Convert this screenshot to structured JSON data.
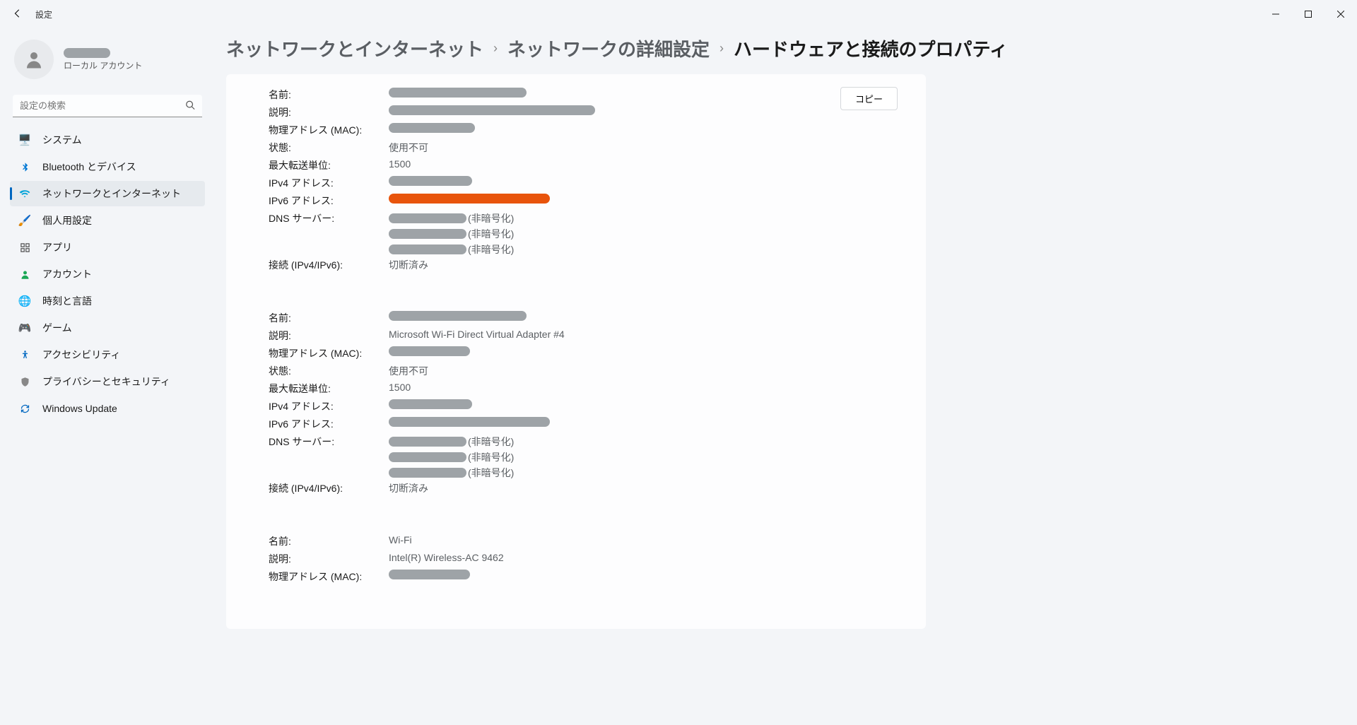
{
  "window": {
    "title": "設定"
  },
  "user": {
    "subtitle": "ローカル アカウント"
  },
  "search": {
    "placeholder": "設定の検索"
  },
  "nav": {
    "items": [
      {
        "key": "system",
        "label": "システム"
      },
      {
        "key": "bluetooth",
        "label": "Bluetooth とデバイス"
      },
      {
        "key": "network",
        "label": "ネットワークとインターネット"
      },
      {
        "key": "personalize",
        "label": "個人用設定"
      },
      {
        "key": "apps",
        "label": "アプリ"
      },
      {
        "key": "account",
        "label": "アカウント"
      },
      {
        "key": "time",
        "label": "時刻と言語"
      },
      {
        "key": "game",
        "label": "ゲーム"
      },
      {
        "key": "access",
        "label": "アクセシビリティ"
      },
      {
        "key": "privacy",
        "label": "プライバシーとセキュリティ"
      },
      {
        "key": "update",
        "label": "Windows Update"
      }
    ],
    "active": "network"
  },
  "breadcrumb": {
    "a": "ネットワークとインターネット",
    "b": "ネットワークの詳細設定",
    "c": "ハードウェアと接続のプロパティ",
    "sep": "›"
  },
  "copyButton": "コピー",
  "labels": {
    "name": "名前:",
    "description": "説明:",
    "mac": "物理アドレス (MAC):",
    "state": "状態:",
    "mtu": "最大転送単位:",
    "ipv4": "IPv4 アドレス:",
    "ipv6": "IPv6 アドレス:",
    "dns": "DNS サーバー:",
    "conn": "接続 (IPv4/IPv6):"
  },
  "dnsSuffix": "(非暗号化)",
  "adapters": [
    {
      "name_redacted": true,
      "description_redacted": true,
      "mac_redacted": true,
      "state": "使用不可",
      "mtu": "1500",
      "ipv4_redacted": true,
      "ipv6_redacted_orange": true,
      "dns_count": 3,
      "conn": "切断済み"
    },
    {
      "name_redacted": true,
      "description": "Microsoft Wi-Fi Direct Virtual Adapter #4",
      "mac_redacted": true,
      "state": "使用不可",
      "mtu": "1500",
      "ipv4_redacted": true,
      "ipv6_redacted": true,
      "dns_count": 3,
      "conn": "切断済み"
    },
    {
      "name": "Wi-Fi",
      "description": "Intel(R) Wireless-AC 9462",
      "mac_redacted": true
    }
  ]
}
